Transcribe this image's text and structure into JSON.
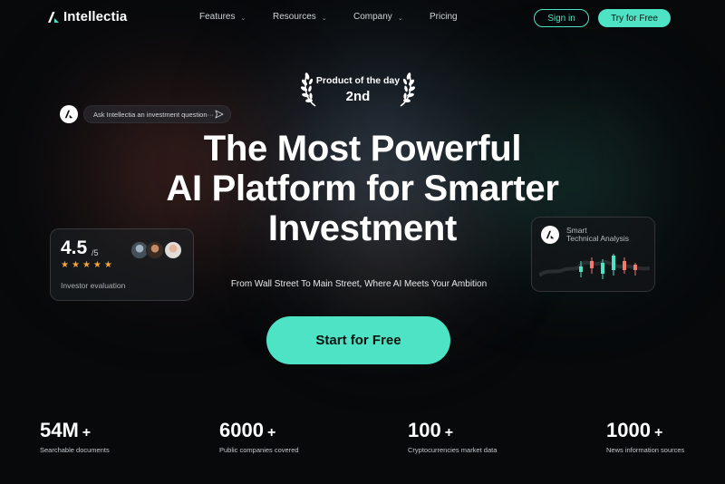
{
  "nav": {
    "brand": "Intellectia",
    "links": [
      {
        "label": "Features",
        "has_dropdown": true
      },
      {
        "label": "Resources",
        "has_dropdown": true
      },
      {
        "label": "Company",
        "has_dropdown": true
      },
      {
        "label": "Pricing",
        "has_dropdown": false
      }
    ],
    "signin_label": "Sign in",
    "try_label": "Try for Free"
  },
  "award": {
    "title": "Product of the day",
    "rank": "2nd"
  },
  "ask": {
    "placeholder": "Ask Intellectia an investment question···"
  },
  "hero": {
    "headline_line1": "The Most Powerful",
    "headline_line2": "AI Platform for Smarter",
    "headline_line3": "Investment",
    "subheadline": "From Wall Street To Main Street, Where AI Meets Your Ambition",
    "cta_label": "Start for Free"
  },
  "rating_card": {
    "value": "4.5",
    "max": "/5",
    "stars": 5,
    "label": "Investor evaluation"
  },
  "ta_card": {
    "title_line1": "Smart",
    "title_line2": "Technical Analysis"
  },
  "stats": [
    {
      "value": "54M",
      "suffix": "+",
      "label": "Searchable documents"
    },
    {
      "value": "6000",
      "suffix": "+",
      "label": "Public companies covered"
    },
    {
      "value": "100",
      "suffix": "+",
      "label": "Cryptocurrencies market data"
    },
    {
      "value": "1000",
      "suffix": "+",
      "label": "News information sources"
    }
  ],
  "colors": {
    "accent": "#4de3c4",
    "background": "#07090b",
    "star": "#f4a63a",
    "candle_up": "#4de3c4",
    "candle_down": "#f07b6a"
  }
}
